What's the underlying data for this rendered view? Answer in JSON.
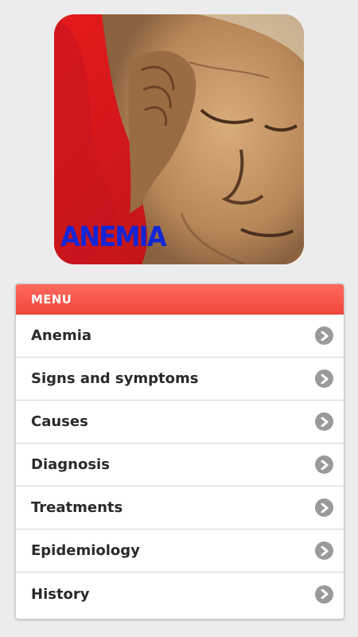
{
  "hero": {
    "caption": "ANEMIA"
  },
  "menu": {
    "header": "MENU",
    "items": [
      {
        "label": "Anemia",
        "icon": "chevron-right-icon"
      },
      {
        "label": "Signs and symptoms",
        "icon": "chevron-right-icon"
      },
      {
        "label": "Causes",
        "icon": "chevron-right-icon"
      },
      {
        "label": "Diagnosis",
        "icon": "chevron-right-icon"
      },
      {
        "label": "Treatments",
        "icon": "chevron-right-icon"
      },
      {
        "label": "Epidemiology",
        "icon": "chevron-right-icon"
      },
      {
        "label": "History",
        "icon": "chevron-right-icon"
      }
    ]
  },
  "colors": {
    "background": "#ececec",
    "header_red": "#f0473c",
    "caption_blue": "#1326d6",
    "chevron_gray": "#9a9a9a"
  }
}
